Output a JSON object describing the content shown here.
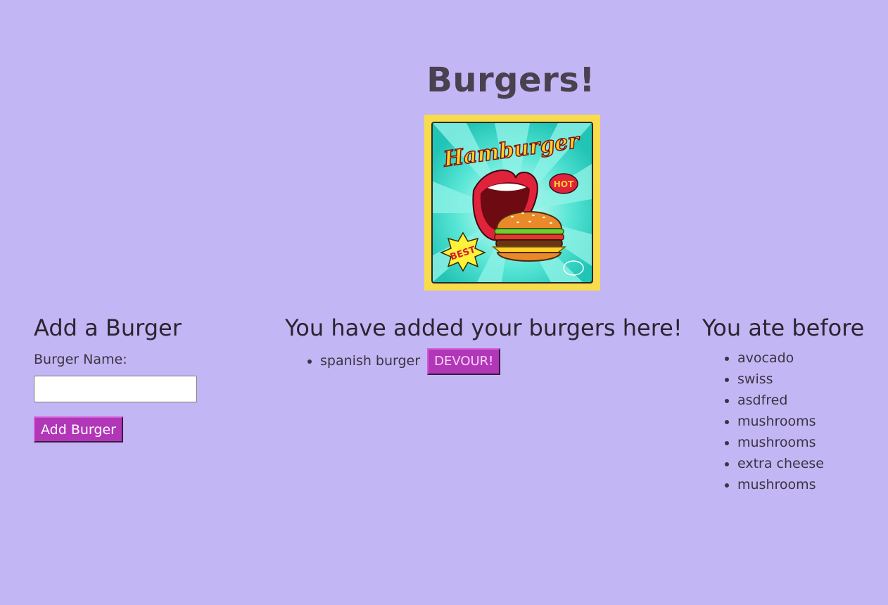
{
  "header": {
    "title": "Burgers!"
  },
  "hero_image": {
    "text_main": "Hamburger",
    "text_badge_hot": "HOT",
    "text_badge_best": "BEST"
  },
  "add_section": {
    "heading": "Add a Burger",
    "field_label": "Burger Name:",
    "input_value": "",
    "button_label": "Add Burger"
  },
  "added_section": {
    "heading": "You have added your burgers here!",
    "items": [
      {
        "name": "spanish burger",
        "button_label": "DEVOUR!"
      }
    ]
  },
  "eaten_section": {
    "heading": "You ate before",
    "items": [
      "avocado",
      "swiss",
      "asdfred",
      "mushrooms",
      "mushrooms",
      "extra cheese",
      "mushrooms"
    ]
  },
  "colors": {
    "background": "#c3b6f4",
    "button": "#b236b8",
    "frame": "#f8dc4b"
  }
}
